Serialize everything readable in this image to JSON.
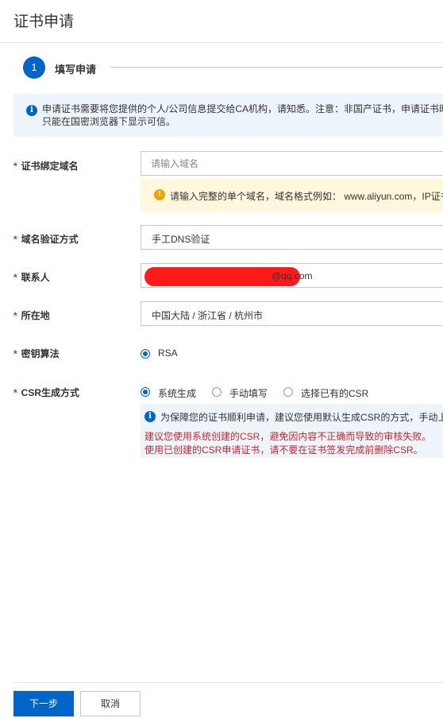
{
  "page": {
    "title": "证书申请"
  },
  "step": {
    "number": "1",
    "label": "填写申请"
  },
  "notice": {
    "line1": "申请证书需要将您提供的个人/公司信息提交给CA机构，请知悉。注意：非国产证书，申请证书时",
    "line2": "只能在国密浏览器下显示可信。"
  },
  "form": {
    "domain": {
      "label": "证书绑定域名",
      "placeholder": "请输入域名",
      "hint": "请输入完整的单个域名，域名格式例如： www.aliyun.com，IP证书"
    },
    "verify_method": {
      "label": "域名验证方式",
      "value": "手工DNS验证"
    },
    "contact": {
      "label": "联系人",
      "value_visible_tail": "@qq.com"
    },
    "location": {
      "label": "所在地",
      "value": "中国大陆 / 浙江省 / 杭州市"
    },
    "key_algorithm": {
      "label": "密钥算法",
      "options": [
        "RSA"
      ],
      "selected": "RSA"
    },
    "csr_method": {
      "label": "CSR生成方式",
      "options": [
        "系统生成",
        "手动填写",
        "选择已有的CSR"
      ],
      "selected": "系统生成",
      "note_line1": "为保障您的证书顺利申请，建议您使用默认生成CSR的方式，手动上",
      "note_line2": "建议您使用系统创建的CSR，避免因内容不正确而导致的审核失败。",
      "note_line3": "使用已创建的CSR申请证书，请不要在证书签发完成前删除CSR。"
    }
  },
  "buttons": {
    "next": "下一步",
    "cancel": "取消"
  },
  "colors": {
    "primary": "#0064c8",
    "warning_bg": "#fff8dc",
    "error_text": "#c8282c",
    "redaction": "#ff1a1a"
  }
}
